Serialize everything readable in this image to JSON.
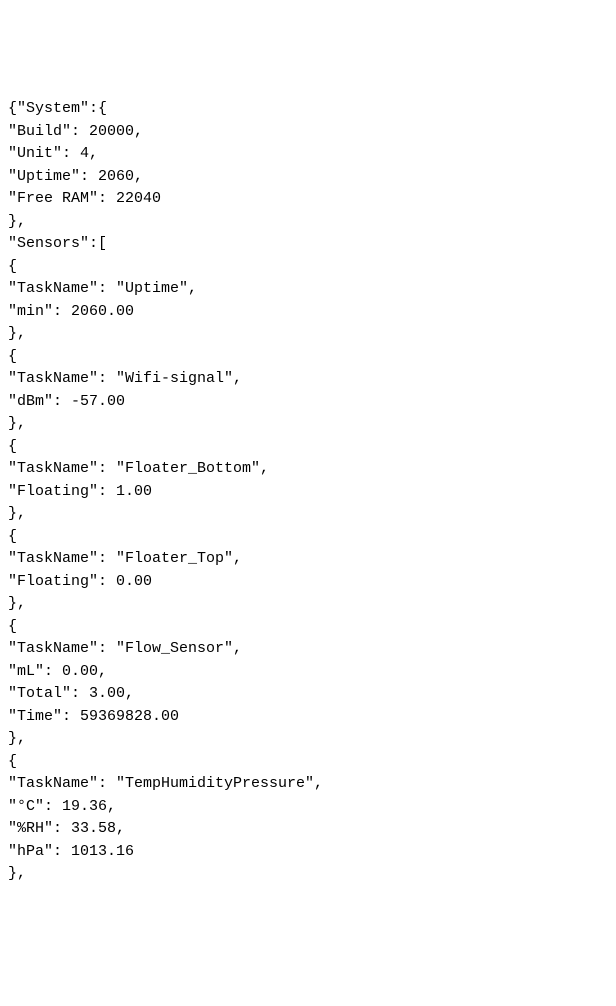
{
  "lines": [
    "{\"System\":{",
    "\"Build\": 20000,",
    "\"Unit\": 4,",
    "\"Uptime\": 2060,",
    "\"Free RAM\": 22040",
    "},",
    "\"Sensors\":[",
    "{",
    "\"TaskName\": \"Uptime\",",
    "\"min\": 2060.00",
    "},",
    "{",
    "\"TaskName\": \"Wifi-signal\",",
    "\"dBm\": -57.00",
    "},",
    "{",
    "\"TaskName\": \"Floater_Bottom\",",
    "\"Floating\": 1.00",
    "},",
    "{",
    "\"TaskName\": \"Floater_Top\",",
    "\"Floating\": 0.00",
    "},",
    "{",
    "\"TaskName\": \"Flow_Sensor\",",
    "\"mL\": 0.00,",
    "\"Total\": 3.00,",
    "\"Time\": 59369828.00",
    "},",
    "{",
    "\"TaskName\": \"TempHumidityPressure\",",
    "\"°C\": 19.36,",
    "\"%RH\": 33.58,",
    "\"hPa\": 1013.16",
    "},"
  ]
}
